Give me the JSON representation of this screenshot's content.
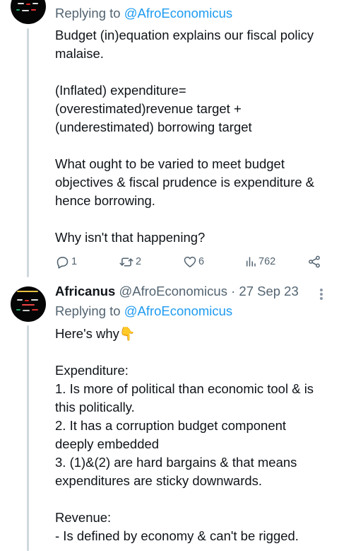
{
  "tweet1": {
    "replying_prefix": "Replying to",
    "replying_handle": "@AfroEconomicus",
    "text": "Budget (in)equation explains our fiscal policy malaise.\n\n(Inflated) expenditure=\n(overestimated)revenue target +\n(underestimated) borrowing target\n\nWhat ought to be varied to meet budget objectives & fiscal prudence is expenditure & hence borrowing.\n\nWhy isn't that happening?",
    "actions": {
      "replies": "1",
      "reposts": "2",
      "likes": "6",
      "views": "762"
    },
    "icons": {
      "reply": "reply-icon",
      "repost": "repost-icon",
      "like": "heart-icon",
      "views": "views-icon",
      "share": "share-icon"
    }
  },
  "tweet2": {
    "author_name": "Africanus",
    "author_handle": "@AfroEconomicus",
    "separator": "·",
    "date": "27 Sep 23",
    "replying_prefix": "Replying to",
    "replying_handle": "@AfroEconomicus",
    "text": "Here's why👇\n\nExpenditure:\n1. Is more of political than economic tool & is this politically.\n2.  It has a corruption budget component deeply embedded\n3. (1)&(2) are hard bargains & that means expenditures are sticky downwards.\n\nRevenue:\n- Is defined by economy & can't be rigged."
  },
  "colors": {
    "text": "#0f1419",
    "secondary": "#536471",
    "link": "#1d9bf0",
    "thread_line": "#cfd9de"
  }
}
